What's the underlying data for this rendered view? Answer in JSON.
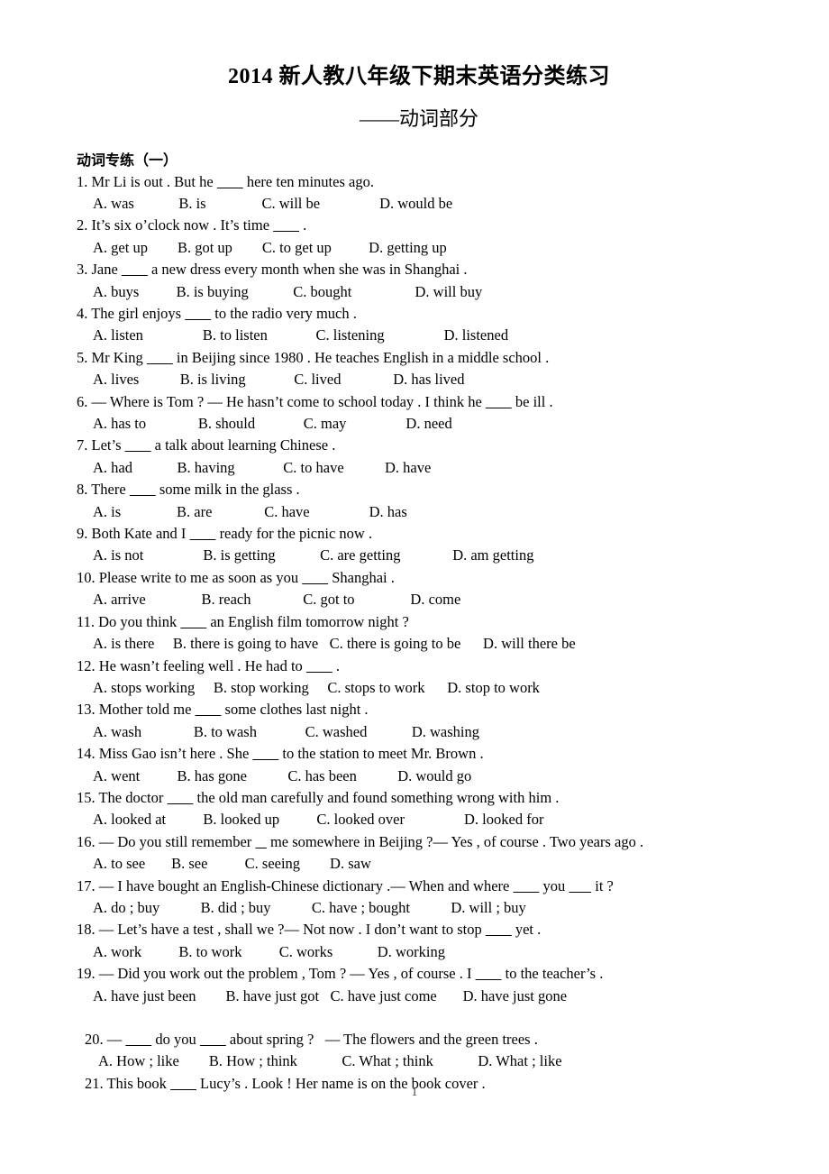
{
  "document": {
    "title": "2014 新人教八年级下期末英语分类练习",
    "subtitle": "——动词部分",
    "section_heading": "动词专练（一）",
    "page_number": "1"
  },
  "questions": [
    {
      "stem": "1. Mr Li is out . But he _______ here ten minutes ago.",
      "options": "A. was            B. is               C. will be                D. would be"
    },
    {
      "stem": "2. It’s six o’clock now . It’s time _______ .",
      "options": "A. get up        B. got up        C. to get up          D. getting up"
    },
    {
      "stem": "3. Jane _______ a new dress every month when she was in Shanghai .",
      "options": "A. buys          B. is buying            C. bought                 D. will buy"
    },
    {
      "stem": "4. The girl enjoys _______ to the radio very much .",
      "options": "A. listen                B. to listen             C. listening                D. listened"
    },
    {
      "stem": "5. Mr King _______ in Beijing since 1980 . He teaches English in a middle school .",
      "options": "A. lives           B. is living             C. lived              D. has lived"
    },
    {
      "stem": "6. — Where is Tom ? — He hasn’t come to school today . I think he _______ be ill .",
      "options": "A. has to              B. should             C. may                D. need"
    },
    {
      "stem": "7. Let’s _______ a talk about learning Chinese .",
      "options": "A. had            B. having             C. to have           D. have"
    },
    {
      "stem": "8. There _______ some milk in the glass .",
      "options": "A. is               B. are              C. have                D. has"
    },
    {
      "stem": "9. Both Kate and I _______ ready for the picnic now .",
      "options": "A. is not                B. is getting            C. are getting              D. am getting"
    },
    {
      "stem": "10. Please write to me as soon as you _______ Shanghai .",
      "options": "A. arrive               B. reach              C. got to               D. come"
    },
    {
      "stem": "11. Do you think _______ an English film tomorrow night ?",
      "options": "A. is there     B. there is going to have   C. there is going to be      D. will there be"
    },
    {
      "stem": "12. He wasn’t feeling well . He had to _______ .",
      "options": "A. stops working     B. stop working     C. stops to work      D. stop to work"
    },
    {
      "stem": "13. Mother told me _______ some clothes last night .",
      "options": "A. wash              B. to wash             C. washed            D. washing"
    },
    {
      "stem": "14. Miss Gao isn’t here . She _______ to the station to meet Mr. Brown .",
      "options": "A. went          B. has gone           C. has been           D. would go"
    },
    {
      "stem": "15. The doctor _______ the old man carefully and found something wrong with him .",
      "options": "A. looked at          B. looked up          C. looked over                D. looked for"
    },
    {
      "stem": "16. — Do you still remember ___ me somewhere in Beijing ?— Yes , of course . Two years ago .",
      "options": "A. to see       B. see          C. seeing        D. saw"
    },
    {
      "stem": "17. — I have bought an English-Chinese dictionary .— When and where _______ you ______ it ?",
      "options": "A. do ; buy           B. did ; buy           C. have ; bought           D. will ; buy"
    },
    {
      "stem": "18. — Let’s have a test , shall we ?— Not now . I don’t want to stop _______ yet .",
      "options": "A. work          B. to work          C. works            D. working"
    },
    {
      "stem": "19. — Did you work out the problem , Tom ? — Yes , of course . I _______ to the teacher’s .",
      "options": "A. have just been        B. have just got   C. have just come       D. have just gone"
    },
    {
      "stem": "20. — _______ do you _______ about spring ?   — The flowers and the green trees .",
      "options": "A. How ; like        B. How ; think            C. What ; think            D. What ; like",
      "gap_before": true,
      "shifted": true
    },
    {
      "stem": "21. This book _______ Lucy’s . Look ! Her name is on the book cover .",
      "options": "",
      "shifted": true
    }
  ]
}
